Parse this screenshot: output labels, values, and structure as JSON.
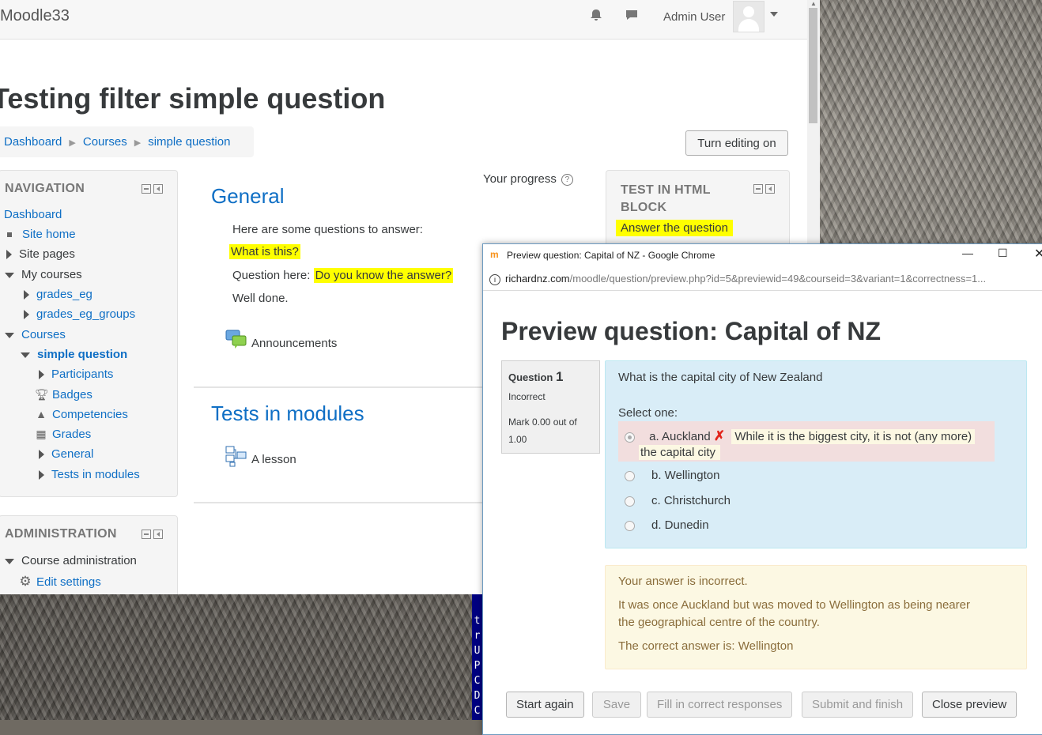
{
  "moodle": {
    "brand": "Moodle33",
    "user_name": "Admin User",
    "page_title": "Testing filter simple question",
    "breadcrumb": [
      "Dashboard",
      "Courses",
      "simple question"
    ],
    "edit_button": "Turn editing on",
    "progress_label": "Your progress",
    "navigation": {
      "title": "NAVIGATION",
      "items": {
        "dashboard": "Dashboard",
        "site_home": "Site home",
        "site_pages": "Site pages",
        "my_courses": "My courses",
        "grades_eg": "grades_eg",
        "grades_eg_groups": "grades_eg_groups",
        "courses": "Courses",
        "simple_question": "simple question",
        "participants": "Participants",
        "badges": "Badges",
        "competencies": "Competencies",
        "grades": "Grades",
        "general": "General",
        "tests_in_modules": "Tests in modules"
      }
    },
    "administration": {
      "title": "ADMINISTRATION",
      "course_admin": "Course administration",
      "edit_settings": "Edit settings"
    },
    "html_block": {
      "title_line1": "TEST IN HTML",
      "title_line2": "BLOCK",
      "link": "Answer the question"
    },
    "general": {
      "title": "General",
      "intro": "Here are some questions to answer:",
      "q1": "What is this?",
      "q2_prefix": "Question here:",
      "q2": "Do you know the answer?",
      "done": "Well done.",
      "announcements": "Announcements"
    },
    "tests": {
      "title": "Tests in modules",
      "lesson": "A lesson"
    }
  },
  "terminal_chars": [
    "t",
    "r",
    "U",
    "P",
    "C",
    "D",
    "C"
  ],
  "chrome": {
    "window_title": "Preview question: Capital of NZ - Google Chrome",
    "url_host": "richardnz.com",
    "url_path": "/moodle/question/preview.php?id=5&previewid=49&courseid=3&variant=1&correctness=1...",
    "preview": {
      "title": "Preview question: Capital of NZ",
      "question_label": "Question",
      "question_number": "1",
      "state": "Incorrect",
      "grade": "Mark 0.00 out of 1.00",
      "question_text": "What is the capital city of New Zealand",
      "prompt": "Select one:",
      "answers": {
        "a": "a. Auckland",
        "a_feedback_1": "While it is the biggest city, it is not (any more)",
        "a_feedback_2": "the capital city",
        "b": "b. Wellington",
        "c": "c. Christchurch",
        "d": "d. Dunedin"
      },
      "outcome": {
        "line1": "Your answer is incorrect.",
        "line2": "It was once Auckland but was moved to Wellington as being nearer",
        "line3": "the geographical centre of the country.",
        "line4": "The correct answer is: Wellington"
      },
      "buttons": {
        "start_again": "Start again",
        "save": "Save",
        "fill_correct": "Fill in correct responses",
        "submit": "Submit and finish",
        "close": "Close preview"
      }
    }
  },
  "colors": {
    "link": "#0f6fc5",
    "highlight": "#ffff00",
    "formulation_bg": "#d9edf7",
    "incorrect_bg": "#f2dede",
    "outcome_bg": "#fcf8e3"
  }
}
